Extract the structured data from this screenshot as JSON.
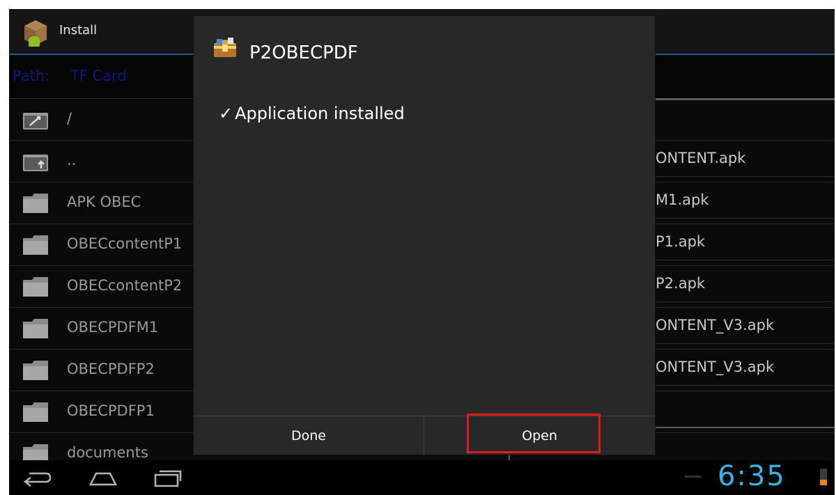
{
  "header": {
    "title": "Install"
  },
  "path": {
    "label": "Path:",
    "value": "TF Card"
  },
  "folders": [
    {
      "name": "/",
      "icon": "folder-up-root-icon"
    },
    {
      "name": "..",
      "icon": "folder-up-icon"
    },
    {
      "name": "APK OBEC",
      "icon": "folder-icon"
    },
    {
      "name": "OBECcontentP1",
      "icon": "folder-icon"
    },
    {
      "name": "OBECcontentP2",
      "icon": "folder-icon"
    },
    {
      "name": "OBECPDFM1",
      "icon": "folder-icon"
    },
    {
      "name": "OBECPDFP2",
      "icon": "folder-icon"
    },
    {
      "name": "OBECPDFP1",
      "icon": "folder-icon"
    },
    {
      "name": "documents",
      "icon": "folder-icon"
    }
  ],
  "files": [
    "ONTENT.apk",
    "M1.apk",
    "P1.apk",
    "P2.apk",
    "ONTENT_V3.apk",
    "ONTENT_V3.apk"
  ],
  "dialog": {
    "title": "P2OBECPDF",
    "check": "✓",
    "message": "Application installed",
    "done_label": "Done",
    "open_label": "Open"
  },
  "status": {
    "time": "6:35"
  },
  "colors": {
    "accent": "#33b5e5",
    "highlight": "#e01a1a",
    "battery": "#f08020"
  }
}
